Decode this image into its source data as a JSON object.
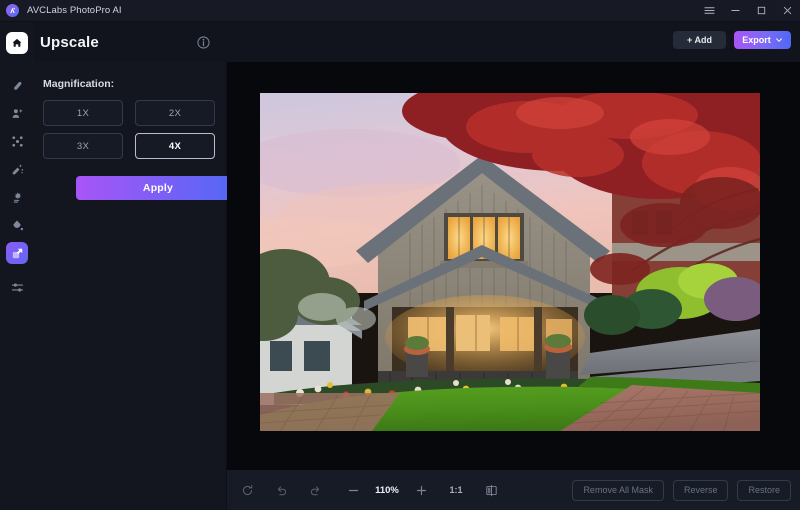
{
  "titlebar": {
    "app_name": "AVCLabs PhotoPro AI",
    "logo_icon": "avclabs-logo-icon",
    "controls": [
      {
        "name": "menu-icon",
        "label": "☰"
      },
      {
        "name": "minimize-icon",
        "label": "─"
      },
      {
        "name": "maximize-icon",
        "label": "□"
      },
      {
        "name": "close-icon",
        "label": "✕"
      }
    ]
  },
  "rail": {
    "home_icon": "home-icon",
    "items": [
      {
        "name": "sidebar-item-enhance",
        "icon": "enhance-icon",
        "active": false
      },
      {
        "name": "sidebar-item-portrait",
        "icon": "portrait-retouch-icon",
        "active": false
      },
      {
        "name": "sidebar-item-background",
        "icon": "background-remove-icon",
        "active": false
      },
      {
        "name": "sidebar-item-object-remove",
        "icon": "magic-eraser-icon",
        "active": false
      },
      {
        "name": "sidebar-item-denoise",
        "icon": "denoise-icon",
        "active": false
      },
      {
        "name": "sidebar-item-colorize",
        "icon": "color-drop-icon",
        "active": false
      },
      {
        "name": "sidebar-item-upscale",
        "icon": "upscale-expand-icon",
        "active": true
      },
      {
        "name": "sidebar-item-adjust",
        "icon": "sliders-icon",
        "active": false
      }
    ]
  },
  "panel": {
    "title": "Upscale",
    "info_icon": "info-icon",
    "magnification_label": "Magnification:",
    "magnification_options": [
      {
        "label": "1X",
        "selected": false
      },
      {
        "label": "2X",
        "selected": false
      },
      {
        "label": "3X",
        "selected": false
      },
      {
        "label": "4X",
        "selected": true
      }
    ],
    "apply_label": "Apply"
  },
  "header_actions": {
    "add_label": "+ Add",
    "export_label": "Export",
    "export_chevron_icon": "chevron-down-icon"
  },
  "canvas": {
    "image_alt": "Craftsman house at dusk with red maple tree, lit windows, green lawn and brick walkway"
  },
  "bottombar": {
    "tools": [
      {
        "name": "reset-button",
        "icon": "refresh-icon"
      },
      {
        "name": "undo-button",
        "icon": "undo-arrow-icon"
      },
      {
        "name": "redo-button",
        "icon": "redo-arrow-icon"
      }
    ],
    "zoom_out_icon": "minus-icon",
    "zoom_level": "110%",
    "zoom_in_icon": "plus-icon",
    "fit_ratio": "1:1",
    "compare_icon": "split-compare-icon",
    "mask_buttons": [
      {
        "name": "remove-all-mask-button",
        "label": "Remove All Mask"
      },
      {
        "name": "reverse-button",
        "label": "Reverse"
      },
      {
        "name": "restore-button",
        "label": "Restore"
      }
    ]
  },
  "colors": {
    "accent_purple": "#a855f7",
    "accent_blue": "#4f68f5",
    "panel_bg": "#13161f",
    "canvas_bg": "#07080c",
    "toolbar_bg": "#161b26"
  }
}
